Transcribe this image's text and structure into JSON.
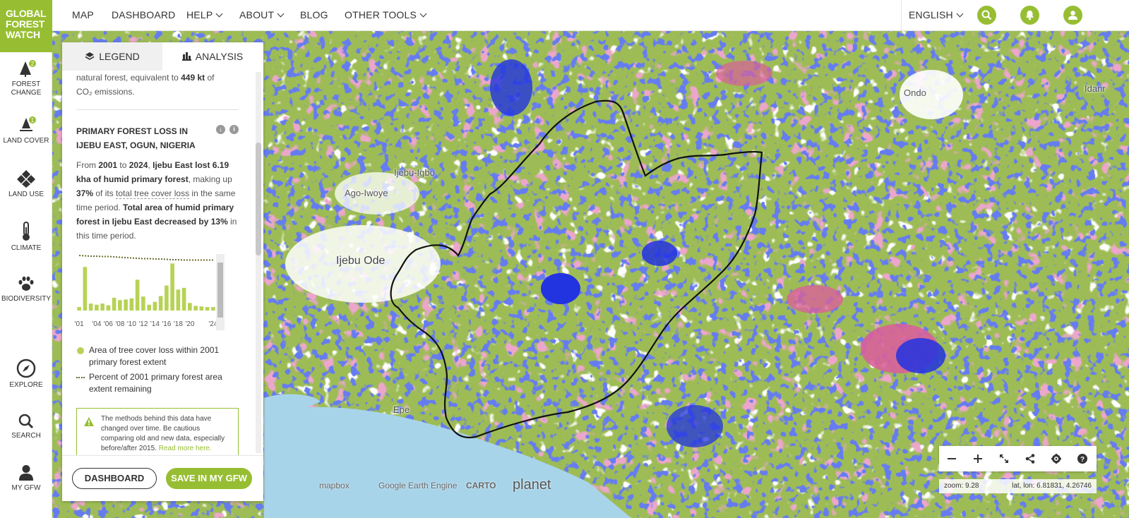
{
  "logo": {
    "line1": "GLOBAL",
    "line2": "FOREST",
    "line3": "WATCH"
  },
  "nav": {
    "items": [
      "MAP",
      "DASHBOARD",
      "HELP",
      "ABOUT",
      "BLOG",
      "OTHER TOOLS"
    ],
    "language": "ENGLISH"
  },
  "sidebar": {
    "forest_change": {
      "label": "FOREST CHANGE",
      "badge": "2"
    },
    "land_cover": {
      "label": "LAND COVER",
      "badge": "1"
    },
    "land_use": {
      "label": "LAND USE"
    },
    "climate": {
      "label": "CLIMATE"
    },
    "biodiversity": {
      "label": "BIODIVERSITY"
    },
    "explore": {
      "label": "EXPLORE"
    },
    "search": {
      "label": "SEARCH"
    },
    "my_gfw": {
      "label": "MY GFW"
    }
  },
  "panel": {
    "tabs": {
      "legend": "LEGEND",
      "analysis": "ANALYSIS"
    },
    "prev_text": {
      "a": "natural forest, equivalent to ",
      "b": "449 kt",
      "c": " of",
      "d": "CO₂ emissions."
    },
    "widget_title": {
      "line1": "PRIMARY FOREST LOSS IN",
      "line2": "IJEBU EAST, OGUN, NIGERIA"
    },
    "sentence": {
      "s1": "From ",
      "s2": "2001",
      "s3": " to ",
      "s4": "2024",
      "s5": ", ",
      "s6": "Ijebu East lost 6.19 kha of humid primary forest",
      "s7": ", making up ",
      "s8": "37%",
      "s9": " of its ",
      "s10": "total tree cover loss",
      "s11": " in the same time period. ",
      "s12": "Total area of humid primary forest in Ijebu East decreased by 13%",
      "s13": " in this time period."
    },
    "legend": {
      "loss": "Area of tree cover loss within 2001 primary forest extent",
      "percent": "Percent of 2001 primary forest area extent remaining"
    },
    "notice": {
      "text": "The methods behind this data have changed over time. Be cautious comparing old and new data, especially before/after 2015. ",
      "link": "Read more here."
    },
    "buttons": {
      "dashboard": "DASHBOARD",
      "save": "SAVE IN MY GFW"
    }
  },
  "chart_data": {
    "type": "bar",
    "categories": [
      "2001",
      "2002",
      "2003",
      "2004",
      "2005",
      "2006",
      "2007",
      "2008",
      "2009",
      "2010",
      "2011",
      "2012",
      "2013",
      "2014",
      "2015",
      "2016",
      "2017",
      "2018",
      "2019",
      "2020",
      "2021",
      "2022",
      "2023",
      "2024"
    ],
    "tick_labels": [
      "'01",
      "'04",
      "'06",
      "'08",
      "'10",
      "'12",
      "'14",
      "'16",
      "'18",
      "'20",
      "'24"
    ],
    "values": [
      0.06,
      0.75,
      0.12,
      0.1,
      0.12,
      0.09,
      0.22,
      0.18,
      0.19,
      0.21,
      0.53,
      0.24,
      0.1,
      0.15,
      0.25,
      0.43,
      0.81,
      0.36,
      0.39,
      0.13,
      0.08,
      0.07,
      0.06,
      0.06
    ],
    "percent_remaining": [
      1.0,
      0.99,
      0.98,
      0.98,
      0.97,
      0.97,
      0.96,
      0.95,
      0.94,
      0.93,
      0.92,
      0.91,
      0.91,
      0.9,
      0.9,
      0.89,
      0.88,
      0.88,
      0.87,
      0.87,
      0.87,
      0.87,
      0.87,
      0.87
    ],
    "bar_color": "#b8d256",
    "line_color": "#6a6a2a"
  },
  "map": {
    "labels": {
      "ijebu_igbo": "Ijebu-Igbo",
      "ago_iwoye": "Ago-Iwoye",
      "ijebu_ode": "Ijebu Ode",
      "ondo": "Ondo",
      "idanre": "Idanr",
      "epe": "Epe"
    },
    "attribution": {
      "mapbox": "mapbox",
      "gee": "Google Earth Engine",
      "carto": "CARTO",
      "planet": "planet"
    },
    "zoom": "zoom: 9.28",
    "latlon": "lat, lon: 6.81831, 4.26746",
    "colors": {
      "forest": "#9dbc55",
      "loss": "#d9609a",
      "gain": "#2233e0",
      "urban": "#ffffff",
      "water": "#a8d4ea"
    }
  }
}
